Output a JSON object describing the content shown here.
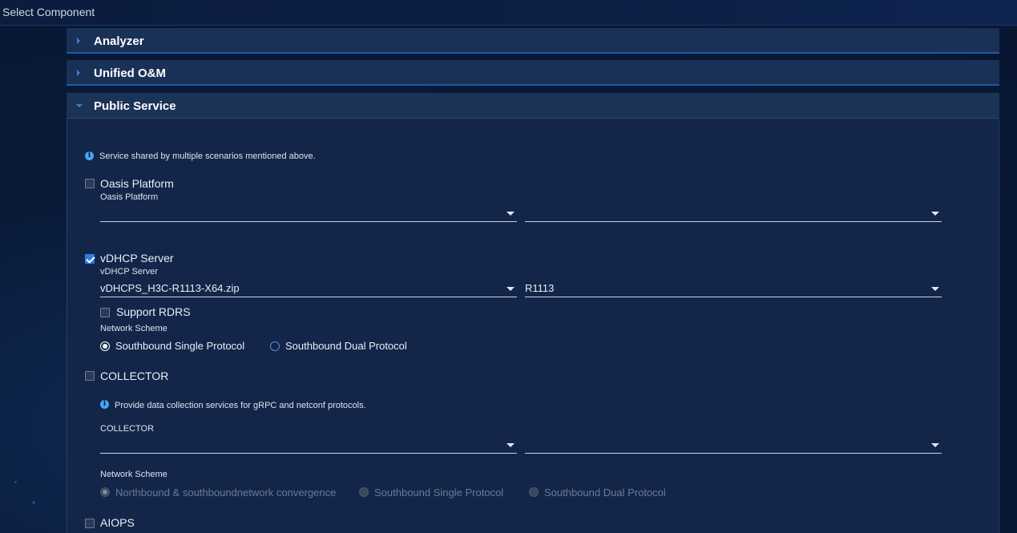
{
  "window": {
    "title": "Select Component"
  },
  "accordion": {
    "sections": [
      {
        "label": "Analyzer"
      },
      {
        "label": "Unified O&M"
      },
      {
        "label": "Public Service"
      }
    ]
  },
  "public_service": {
    "info_text": "Service shared by multiple scenarios mentioned above.",
    "oasis": {
      "checkbox_label": "Oasis Platform",
      "field_label": "Oasis Platform",
      "package_value": "",
      "version_value": ""
    },
    "vdhcp": {
      "checkbox_label": "vDHCP Server",
      "field_label": "vDHCP Server",
      "package_value": "vDHCPS_H3C-R1113-X64.zip",
      "version_value": "R1113",
      "support_rdrs_label": "Support RDRS",
      "network_scheme_label": "Network Scheme",
      "radio_options": [
        "Southbound Single Protocol",
        "Southbound Dual Protocol"
      ],
      "selected_option": "Southbound Single Protocol"
    },
    "collector": {
      "checkbox_label": "COLLECTOR",
      "info_text": "Provide data collection services for gRPC and netconf protocols.",
      "field_label": "COLLECTOR",
      "package_value": "",
      "version_value": "",
      "network_scheme_label": "Network Scheme",
      "radio_options": [
        "Northbound & southboundnetwork convergence",
        "Southbound Single Protocol",
        "Southbound Dual Protocol"
      ],
      "selected_option": "Northbound & southboundnetwork convergence"
    },
    "aiops": {
      "checkbox_label": "AIOPS"
    }
  },
  "icons": {
    "info": "info-icon",
    "caret_collapsed": "chevron-right-icon",
    "caret_expanded": "chevron-down-icon",
    "dropdown": "chevron-down-icon"
  },
  "colors": {
    "accent": "#2f7de1",
    "header_bg": "#1a3157",
    "body_bg": "#13264a"
  }
}
